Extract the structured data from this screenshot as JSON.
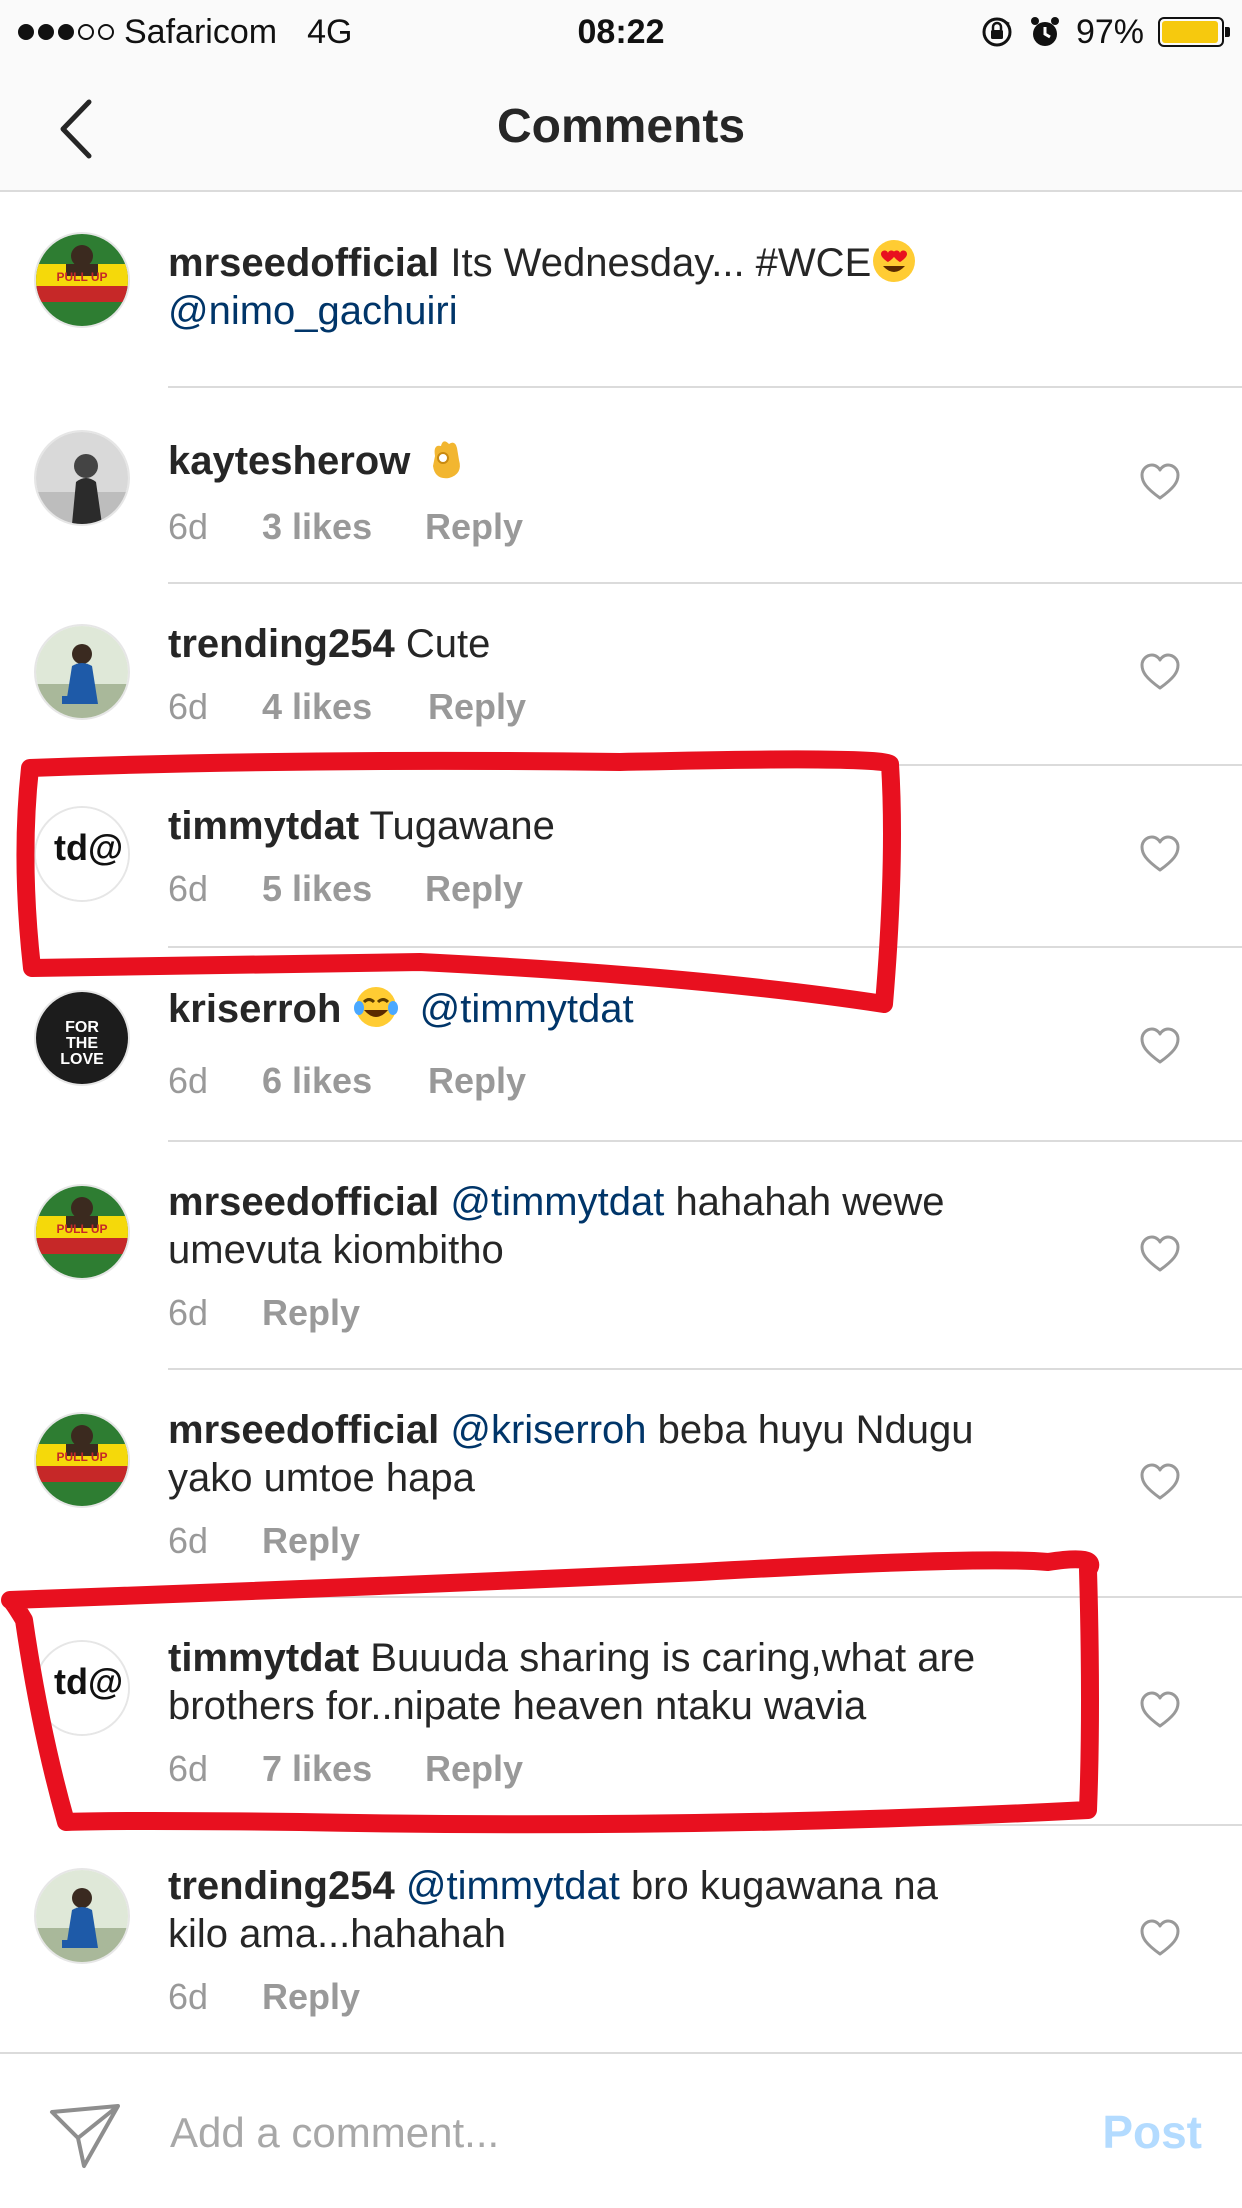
{
  "status_bar": {
    "carrier": "Safaricom",
    "network": "4G",
    "time": "08:22",
    "battery": "97%",
    "battery_level": 0.97,
    "signal_bars_filled": 3,
    "signal_bars_total": 5,
    "icons": [
      "rotation-lock-icon",
      "alarm-icon",
      "battery-icon"
    ]
  },
  "header": {
    "title": "Comments",
    "back_icon": "chevron-left-icon"
  },
  "caption": {
    "username": "mrseedofficial",
    "text": "Its Wednesday... #WCE",
    "emoji": "heart-eyes-emoji",
    "mention": "@nimo_gachuiri"
  },
  "comments": [
    {
      "username": "kaytesherow",
      "text": "",
      "emoji": "ok-hand-emoji",
      "age": "6d",
      "likes": "3 likes",
      "reply": "Reply"
    },
    {
      "username": "trending254",
      "text": "Cute",
      "age": "6d",
      "likes": "4 likes",
      "reply": "Reply"
    },
    {
      "username": "timmytdat",
      "text": "Tugawane",
      "age": "6d",
      "likes": "5 likes",
      "reply": "Reply",
      "highlighted": true
    },
    {
      "username": "kriserroh",
      "emoji": "tears-of-joy-emoji",
      "mention": "@timmytdat",
      "age": "6d",
      "likes": "6 likes",
      "reply": "Reply"
    },
    {
      "username": "mrseedofficial",
      "mention": "@timmytdat",
      "text_line1": "hahahah wewe",
      "text_line2": "umevuta kiombitho",
      "age": "6d",
      "reply": "Reply"
    },
    {
      "username": "mrseedofficial",
      "mention": "@kriserroh",
      "text_line1": "beba huyu Ndugu",
      "text_line2": "yako umtoe hapa",
      "age": "6d",
      "reply": "Reply"
    },
    {
      "username": "timmytdat",
      "text_line1": "Buuuda sharing is caring,what are",
      "text_line2": "brothers for..nipate heaven ntaku wavia",
      "age": "6d",
      "likes": "7 likes",
      "reply": "Reply",
      "highlighted": true
    },
    {
      "username": "trending254",
      "mention": "@timmytdat",
      "text_line1": "bro kugawana na",
      "text_line2": "kilo ama...hahahah",
      "age": "6d",
      "reply": "Reply"
    }
  ],
  "avatars": {
    "mrseedofficial": "PULL UP",
    "timmytdat": "td@",
    "kriserroh_lines": [
      "FOR",
      "THE",
      "LOVE"
    ]
  },
  "footer": {
    "placeholder": "Add a comment...",
    "post_label": "Post",
    "send_icon": "paper-plane-icon"
  },
  "colors": {
    "mention": "#003569",
    "meta_gray": "#999999",
    "separator": "#dbdbdb",
    "annotation_red": "#e8101f",
    "post_disabled": "#b3dbff",
    "battery": "#f6c90e"
  }
}
